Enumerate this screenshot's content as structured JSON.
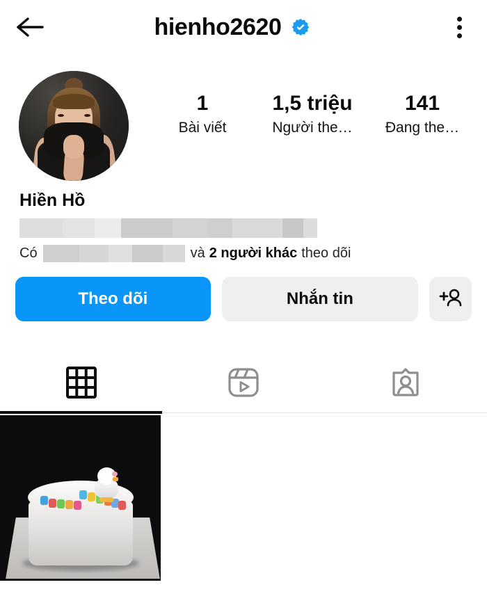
{
  "app": "instagram-profile",
  "colors": {
    "accent_blue": "#0a95f8",
    "verified_blue": "#1d9bf0",
    "button_gray": "#efefef",
    "text_primary": "#0b0b0b",
    "screenshot_border_red": "#e76b6b"
  },
  "topbar": {
    "back_icon": "back-arrow-icon",
    "username": "hienho2620",
    "verified_icon": "verified-badge-icon",
    "menu_icon": "more-options-icon"
  },
  "profile": {
    "avatar_alt": "profile-picture",
    "display_name": "Hiền Hồ",
    "bio_redacted": true,
    "stats": [
      {
        "value": "1",
        "label": "Bài viết",
        "name": "posts"
      },
      {
        "value": "1,5 triệu",
        "label": "Người the…",
        "name": "followers"
      },
      {
        "value": "141",
        "label": "Đang the…",
        "name": "following"
      }
    ],
    "followed_by": {
      "prefix": "Có",
      "redacted": true,
      "middle": "và",
      "bold": "2 người khác",
      "suffix": "theo dõi"
    }
  },
  "actions": {
    "follow_label": "Theo dõi",
    "message_label": "Nhắn tin",
    "add_person_icon": "add-person-icon"
  },
  "tabs": [
    {
      "name": "grid",
      "icon": "grid-icon",
      "active": true
    },
    {
      "name": "reels",
      "icon": "reels-icon",
      "active": false
    },
    {
      "name": "tagged",
      "icon": "tagged-icon",
      "active": false
    }
  ],
  "grid": {
    "posts": [
      {
        "name": "post-thumbnail-1",
        "alt": "white birthday cake with colorful happy birthday letters and a duck figurine on dark background"
      }
    ],
    "empty_cells": 2
  }
}
